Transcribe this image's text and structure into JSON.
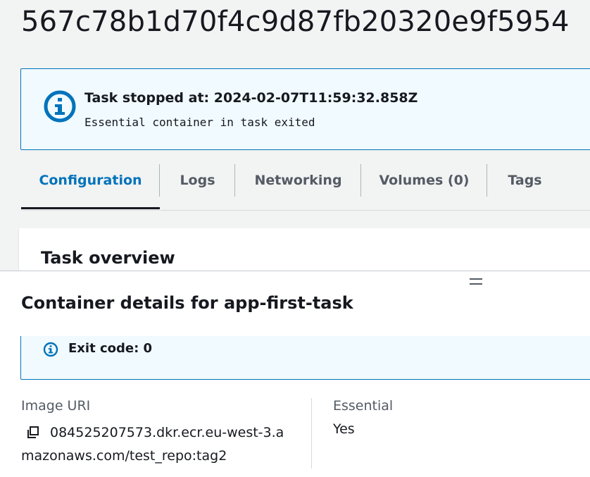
{
  "task": {
    "id": "567c78b1d70f4c9d87fb20320e9f5954"
  },
  "alert": {
    "icon": "info-icon",
    "title": "Task stopped at: 2024-02-07T11:59:32.858Z",
    "message": "Essential container in task exited"
  },
  "tabs": [
    {
      "label": "Configuration",
      "active": true
    },
    {
      "label": "Logs",
      "active": false
    },
    {
      "label": "Networking",
      "active": false
    },
    {
      "label": "Volumes (0)",
      "active": false
    },
    {
      "label": "Tags",
      "active": false
    }
  ],
  "overview": {
    "title": "Task overview"
  },
  "container_panel": {
    "title": "Container details for app-first-task",
    "exit_code": "Exit code: 0",
    "image_uri_label": "Image URI",
    "image_uri_line1": "084525207573.dkr.ecr.eu-west-3.a",
    "image_uri_line2": "mazonaws.com/test_repo:tag2",
    "essential_label": "Essential",
    "essential_value": "Yes"
  },
  "colors": {
    "accent": "#0073bb",
    "info_bg": "#f1faff",
    "text": "#16191f",
    "muted": "#545b64",
    "page_bg": "#f2f3f3"
  }
}
